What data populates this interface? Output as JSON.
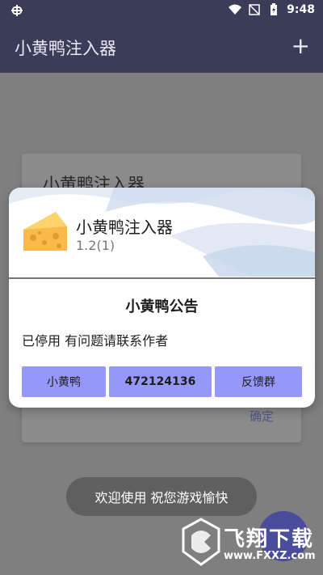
{
  "status_bar": {
    "time": "9:48",
    "left_icon": "bug-icon"
  },
  "app_bar": {
    "title": "小黄鸭注入器",
    "add_icon": "+"
  },
  "background_card": {
    "title": "小黄鸭注入器",
    "ok_label": "确定"
  },
  "dialog": {
    "app_name": "小黄鸭注入器",
    "version": "1.2(1)",
    "notice_title": "小黄鸭公告",
    "notice_body": "已停用 有问题请联系作者",
    "buttons": [
      "小黄鸭",
      "472124136",
      "反馈群"
    ]
  },
  "toast": {
    "text": "欢迎使用 祝您游戏愉快"
  },
  "watermark": {
    "brand": "飞翔下载",
    "domain": "www.FXXZ.com"
  },
  "colors": {
    "appbar": "#3a3c58",
    "button": "#9597f9",
    "toast": "#5f5f5f"
  }
}
